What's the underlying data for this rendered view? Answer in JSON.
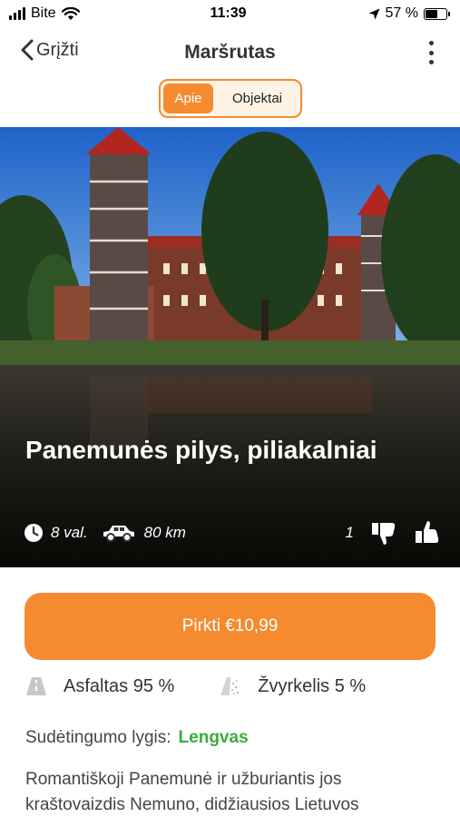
{
  "status_bar": {
    "carrier": "Bite",
    "time": "11:39",
    "battery": "57 %",
    "battery_level": 0.57
  },
  "nav": {
    "back_label": "Grįžti",
    "title": "Maršrutas"
  },
  "tabs": [
    {
      "label": "Apie",
      "active": true
    },
    {
      "label": "Objektai",
      "active": false
    }
  ],
  "route": {
    "title": "Panemunės pilys, piliakalniai",
    "duration": "8 val.",
    "distance": "80 km",
    "dislikes": "1"
  },
  "buy_button_label": "Pirkti €10,99",
  "road_types": [
    {
      "label": "Asfaltas 95 %",
      "icon": "asphalt-road-icon"
    },
    {
      "label": "Žvyrkelis 5 %",
      "icon": "gravel-road-icon"
    }
  ],
  "difficulty": {
    "label": "Sudėtingumo lygis:",
    "value": "Lengvas"
  },
  "description": "Romantiškoji Panemunė ir užburiantis jos kraštovaizdis Nemuno, didžiausios Lietuvos",
  "colors": {
    "accent": "#f58a2f",
    "difficulty_easy": "#3bab3e"
  }
}
